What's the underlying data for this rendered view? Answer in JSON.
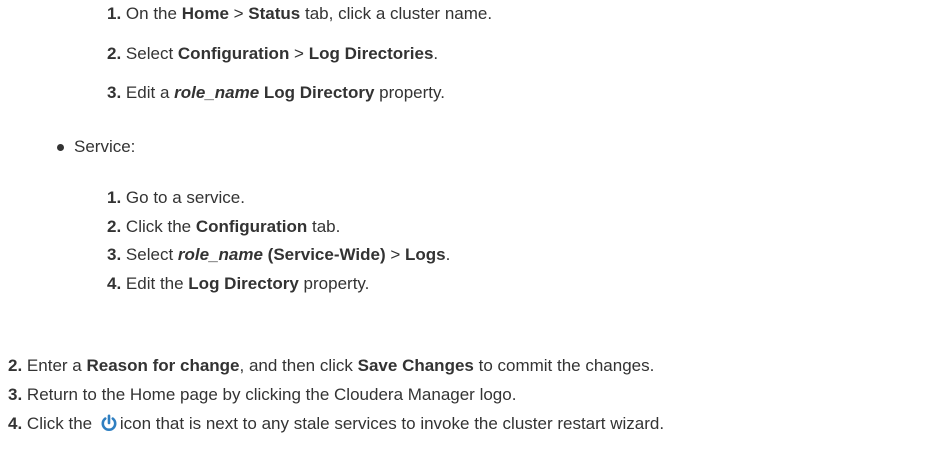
{
  "substeps_cluster": [
    {
      "num": "1.",
      "t1": "On the ",
      "b1": "Home",
      "t2": " > ",
      "b2": "Status",
      "t3": " tab, click a cluster name."
    },
    {
      "num": "2.",
      "t1": "Select ",
      "b1": "Configuration",
      "t2": " > ",
      "b2": "Log Directories",
      "t3": "."
    },
    {
      "num": "3.",
      "t1": "Edit a ",
      "bi": "role_name",
      "b1": " Log Directory",
      "t2": " property."
    }
  ],
  "service_bullet": "Service:",
  "substeps_service": [
    {
      "num": "1.",
      "t1": "Go to a service."
    },
    {
      "num": "2.",
      "t1": "Click the ",
      "b1": "Configuration",
      "t2": " tab."
    },
    {
      "num": "3.",
      "t1": "Select ",
      "bi": "role_name",
      "b1": " (Service-Wide)",
      "t2": " > ",
      "b2": "Logs",
      "t3": "."
    },
    {
      "num": "4.",
      "t1": "Edit the ",
      "b1": "Log Directory",
      "t2": " property."
    }
  ],
  "main_steps": [
    {
      "num": "2.",
      "t1": "Enter a ",
      "b1": "Reason for change",
      "t2": ", and then click ",
      "b2": "Save Changes",
      "t3": " to commit the changes."
    },
    {
      "num": "3.",
      "t1": "Return to the Home page by clicking the Cloudera Manager logo."
    },
    {
      "num": "4.",
      "t1": "Click the ",
      "t2": "icon that is next to any stale services to invoke the cluster restart wizard."
    }
  ],
  "icon": "power-icon",
  "colors": {
    "text": "#333333",
    "icon": "#2f7fc1"
  }
}
